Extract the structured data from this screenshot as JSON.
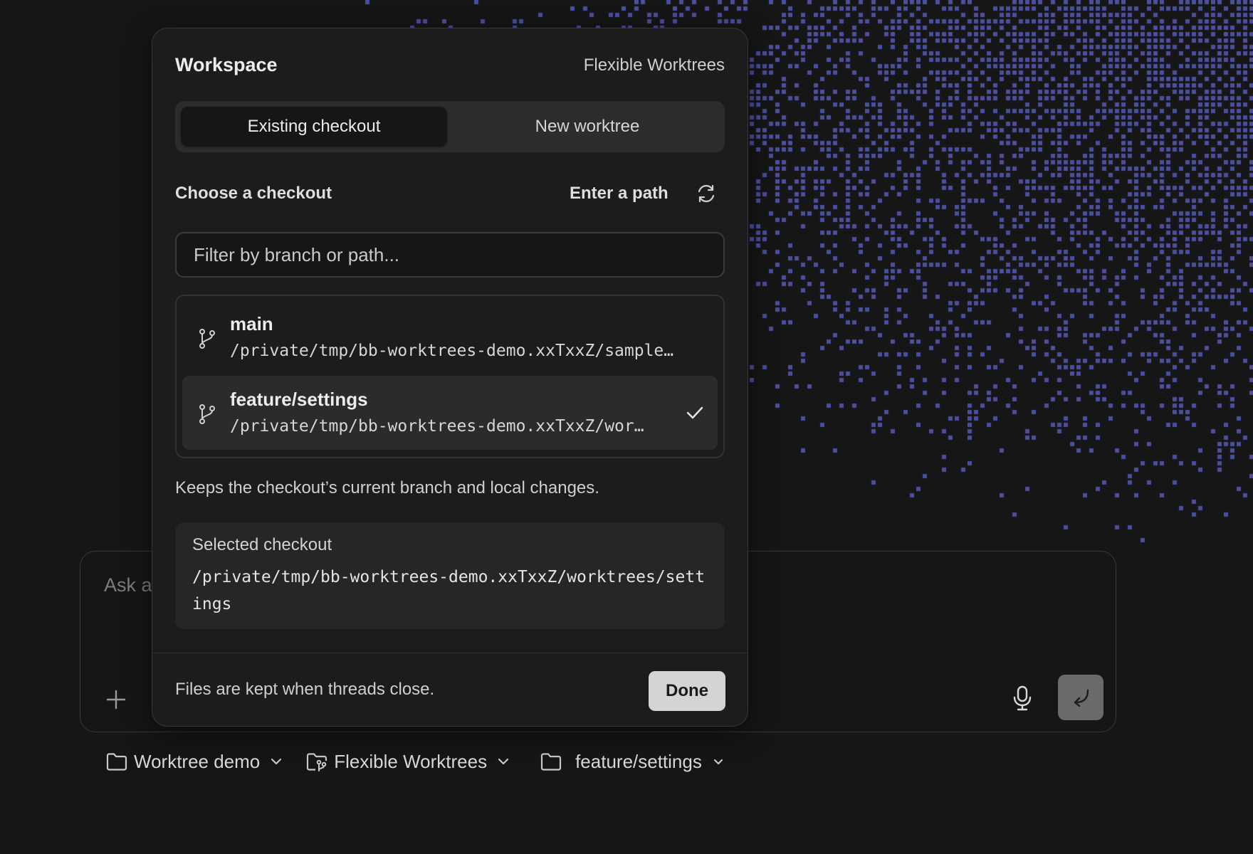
{
  "popover": {
    "title": "Workspace",
    "project": "Flexible Worktrees",
    "tabs": [
      {
        "label": "Existing checkout",
        "active": true
      },
      {
        "label": "New worktree",
        "active": false
      }
    ],
    "section_label": "Choose a checkout",
    "enter_path_label": "Enter a path",
    "filter_placeholder": "Filter by branch or path...",
    "checkouts": [
      {
        "branch": "main",
        "path": "/private/tmp/bb-worktrees-demo.xxTxxZ/sample…",
        "selected": false
      },
      {
        "branch": "feature/settings",
        "path": "/private/tmp/bb-worktrees-demo.xxTxxZ/wor…",
        "selected": true
      }
    ],
    "note": "Keeps the checkout’s current branch and local changes.",
    "selected_label": "Selected checkout",
    "selected_path": "/private/tmp/bb-worktrees-demo.xxTxxZ/worktrees/settings",
    "footer_note": "Files are kept when threads close.",
    "done_label": "Done"
  },
  "composer": {
    "placeholder": "Ask a"
  },
  "toolbar": {
    "items": [
      {
        "label": "Worktree demo",
        "icon": "folder-icon"
      },
      {
        "label": "Flexible Worktrees",
        "icon": "folder-branch-icon"
      },
      {
        "label": "feature/settings",
        "icon": "folder-icon"
      }
    ]
  },
  "colors": {
    "background": "#161617",
    "popover": "#1c1c1d",
    "pattern": "#4b4f9e",
    "done_button": "#d4d4d6",
    "send_button": "#6a6a6c"
  }
}
